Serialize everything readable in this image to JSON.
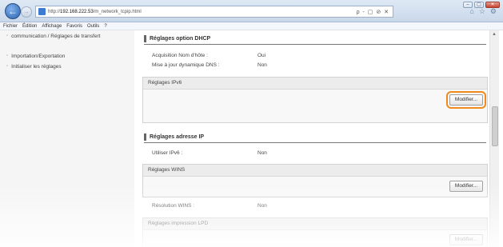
{
  "browser": {
    "url_prefix": "http://",
    "url_host": "192.168.222.53",
    "url_path": "/m_network_tcpip.html",
    "search_placeholder": "ρ - ▢ ⊘ ✕",
    "win_min": "–",
    "win_max": "▢",
    "win_close": "✕"
  },
  "menubar": {
    "items": [
      "Fichier",
      "Édition",
      "Affichage",
      "Favoris",
      "Outils",
      "?"
    ]
  },
  "sidebar": {
    "items": [
      {
        "label": "communication / Réglages de transfert"
      },
      {
        "label": "Importation/Exportation"
      },
      {
        "label": "Initialiser les réglages"
      }
    ]
  },
  "main": {
    "dhcp_section": {
      "title": "Réglages option DHCP",
      "rows": [
        {
          "label": "Acquisition Nom d'hôte :",
          "value": "Oui"
        },
        {
          "label": "Mise à jour dynamique DNS :",
          "value": "Non"
        }
      ]
    },
    "ipv6_band": {
      "label": "Réglages IPv6",
      "button": "Modifier..."
    },
    "ip_section": {
      "title": "Réglages adresse IP",
      "rows": [
        {
          "label": "Utiliser IPv6 :",
          "value": "Non"
        }
      ]
    },
    "wins_band": {
      "label": "Réglages WINS",
      "button": "Modifier..."
    },
    "wins_rows": [
      {
        "label": "Résolution WINS :",
        "value": "Non"
      }
    ],
    "lpd_band": {
      "label": "Réglages impression LPD",
      "button": "Modifier..."
    }
  },
  "colors": {
    "highlight": "#f08a1c"
  }
}
